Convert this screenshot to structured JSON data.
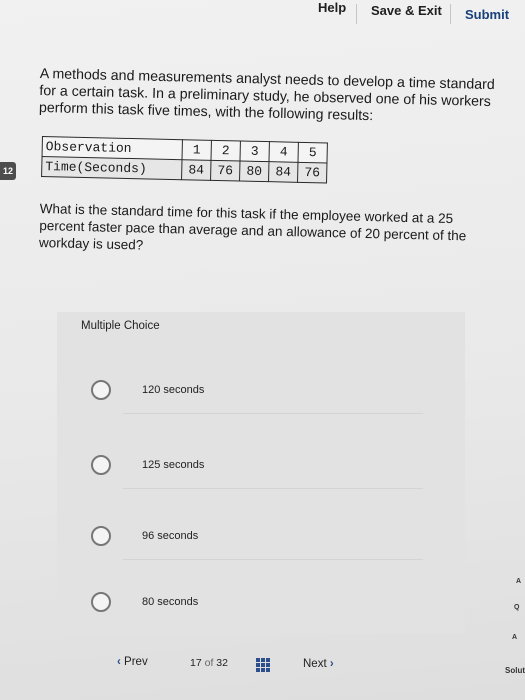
{
  "header": {
    "help_label": "Help",
    "save_exit_label": "Save & Exit",
    "submit_label": "Submit"
  },
  "side_question_number": "12",
  "question": {
    "text": "A methods and measurements analyst needs to develop a time standard for a certain task. In a preliminary study, he observed one of his workers perform this task five times, with the following results:",
    "table": {
      "row1_header": "Observation",
      "row2_header": "Time(Seconds)",
      "observations": [
        "1",
        "2",
        "3",
        "4",
        "5"
      ],
      "times": [
        "84",
        "76",
        "80",
        "84",
        "76"
      ]
    },
    "prompt": "What is the standard time for this task if the employee worked at a 25 percent faster pace than average and an allowance of 20 percent of the workday is used?"
  },
  "multiple_choice": {
    "title": "Multiple Choice",
    "options": [
      "120 seconds",
      "125 seconds",
      "96 seconds",
      "80 seconds"
    ]
  },
  "footer": {
    "prev_label": "Prev",
    "current_page": "17",
    "of_label": "of",
    "total_pages": "32",
    "next_label": "Next"
  },
  "right_edge": {
    "solut_label": "Solut",
    "marks": [
      "A",
      "Q",
      "A"
    ]
  },
  "colors": {
    "accent": "#2d4f8e",
    "submit": "#19407a"
  }
}
